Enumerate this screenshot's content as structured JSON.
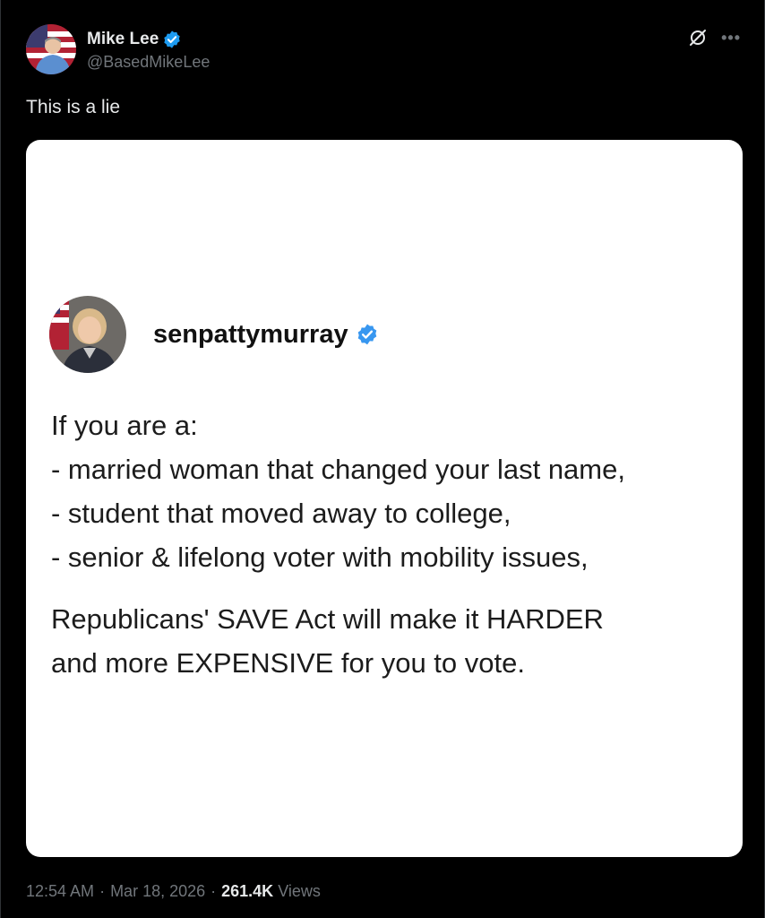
{
  "author": {
    "display_name": "Mike Lee",
    "handle": "@BasedMikeLee"
  },
  "post": {
    "text": "This is a lie"
  },
  "embedded_image": {
    "author_name": "senpattymurray",
    "intro": "If you are a:",
    "list_items": [
      "- married woman that changed your last name,",
      "- student that moved away to college,",
      "- senior & lifelong voter with mobility issues,"
    ],
    "closing_line_1": "Republicans' SAVE Act will make it HARDER",
    "closing_line_2": "and more EXPENSIVE for you to vote."
  },
  "footer": {
    "time": "12:54 AM",
    "separator": "·",
    "date": "Mar 18, 2026",
    "views_count": "261.4K",
    "views_label": "Views"
  },
  "icons": {
    "verified": "verified-badge-icon",
    "grok": "grok-icon",
    "more": "more-options-icon"
  },
  "colors": {
    "background": "#000000",
    "text_primary": "#e7e9ea",
    "text_secondary": "#71767b",
    "verified_blue": "#1d9bf0",
    "instagram_verified_blue": "#3897f0"
  }
}
